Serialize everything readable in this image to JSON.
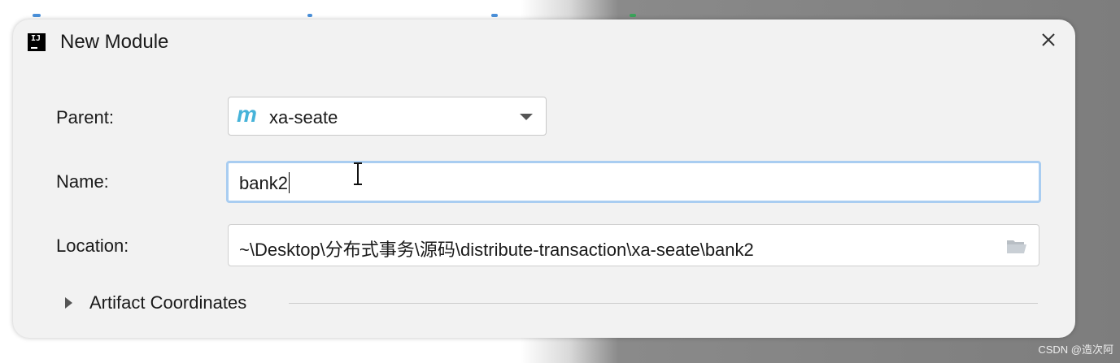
{
  "dialog": {
    "title": "New Module"
  },
  "form": {
    "parent_label": "Parent:",
    "parent_value": "xa-seate",
    "parent_icon_letter": "m",
    "name_label": "Name:",
    "name_value": "bank2",
    "location_label": "Location:",
    "location_value": "~\\Desktop\\分布式事务\\源码\\distribute-transaction\\xa-seate\\bank2"
  },
  "sections": {
    "artifact_coordinates": "Artifact Coordinates"
  },
  "icons": {
    "app": "intellij-icon",
    "close": "close-icon",
    "dropdown": "chevron-down-icon",
    "folder": "folder-icon",
    "expand": "triangle-right-icon",
    "module": "maven-module-icon"
  },
  "colors": {
    "dialog_bg": "#f2f2f2",
    "focus_border": "#a9cdf1",
    "maven_icon": "#46b3d9"
  },
  "watermark": "CSDN @造次阿"
}
